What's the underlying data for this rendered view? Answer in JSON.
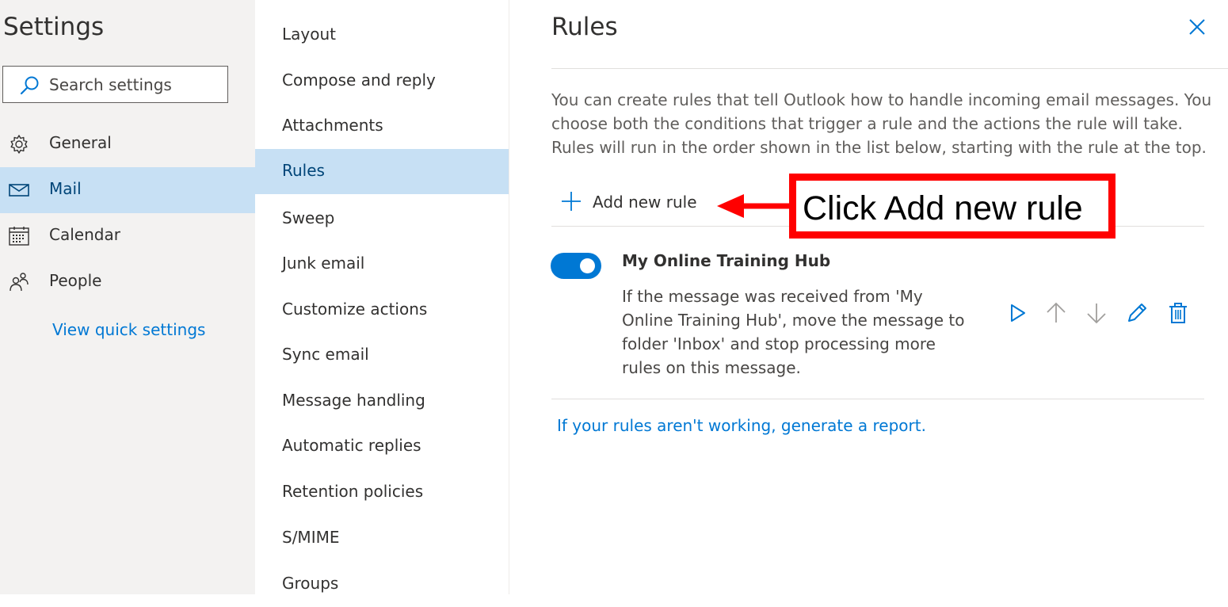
{
  "settings": {
    "title": "Settings",
    "search": {
      "placeholder": "Search settings",
      "value": ""
    },
    "categories": [
      {
        "label": "General",
        "icon": "gear-icon",
        "selected": false
      },
      {
        "label": "Mail",
        "icon": "mail-icon",
        "selected": true
      },
      {
        "label": "Calendar",
        "icon": "calendar-icon",
        "selected": false
      },
      {
        "label": "People",
        "icon": "people-icon",
        "selected": false
      }
    ],
    "quick_settings_link": "View quick settings"
  },
  "mail_subcategories": [
    {
      "label": "Layout",
      "selected": false
    },
    {
      "label": "Compose and reply",
      "selected": false
    },
    {
      "label": "Attachments",
      "selected": false
    },
    {
      "label": "Rules",
      "selected": true
    },
    {
      "label": "Sweep",
      "selected": false
    },
    {
      "label": "Junk email",
      "selected": false
    },
    {
      "label": "Customize actions",
      "selected": false
    },
    {
      "label": "Sync email",
      "selected": false
    },
    {
      "label": "Message handling",
      "selected": false
    },
    {
      "label": "Automatic replies",
      "selected": false
    },
    {
      "label": "Retention policies",
      "selected": false
    },
    {
      "label": "S/MIME",
      "selected": false
    },
    {
      "label": "Groups",
      "selected": false
    }
  ],
  "rules_panel": {
    "title": "Rules",
    "description_lines": [
      "You can create rules that tell Outlook how to handle incoming email messages. You",
      "choose both the conditions that trigger a rule and the actions the rule will take.",
      "Rules will run in the order shown in the list below, starting with the rule at the top."
    ],
    "add_rule_label": "Add new rule",
    "rules": [
      {
        "name": "My Online Training Hub",
        "enabled": true,
        "description_lines": [
          "If the message was received from 'My",
          "Online Training Hub', move the message to",
          "folder 'Inbox' and stop processing more",
          "rules on this message."
        ],
        "actions": [
          "play-icon",
          "arrow-up-icon",
          "arrow-down-icon",
          "pencil-icon",
          "trash-icon"
        ]
      }
    ],
    "report_link": "If your rules aren't working, generate a report."
  },
  "annotation": {
    "text": "Click Add new rule",
    "color": "#ff0000"
  },
  "colors": {
    "accent": "#0078d4",
    "selected_bg": "#c7e0f4",
    "sidebar_bg": "#f3f2f1",
    "text": "#323130"
  }
}
